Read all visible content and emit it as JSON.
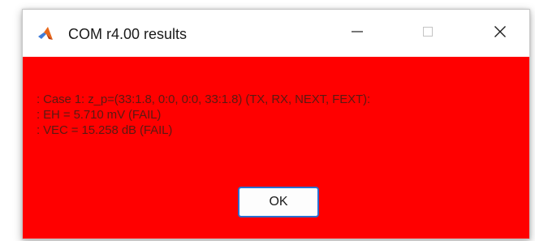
{
  "window": {
    "title": "COM r4.00 results",
    "background_color": "#ff0000",
    "icon": "matlab-icon"
  },
  "controls": {
    "minimize_icon": "minimize-icon",
    "maximize_icon": "maximize-icon",
    "close_icon": "close-icon"
  },
  "message": {
    "lines": [
      ": Case 1: z_p=(33:1.8, 0:0, 0:0, 33:1.8) (TX, RX, NEXT, FEXT):",
      ": EH = 5.710 mV (FAIL)",
      ": VEC = 15.258 dB (FAIL)"
    ]
  },
  "buttons": {
    "ok_label": "OK"
  }
}
